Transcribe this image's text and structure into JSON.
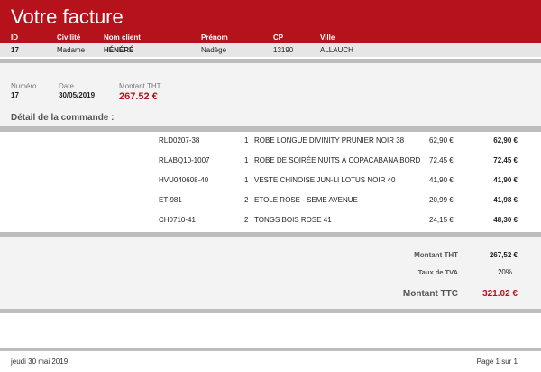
{
  "invoice": {
    "title": "Votre facture",
    "client_headers": {
      "id": "ID",
      "civilite": "Civilité",
      "nom": "Nom client",
      "prenom": "Prénom",
      "cp": "CP",
      "ville": "Ville"
    },
    "client": {
      "id": "17",
      "civilite": "Madame",
      "nom": "HÉNÉRÉ",
      "prenom": "Nadège",
      "cp": "13190",
      "ville": "ALLAUCH"
    },
    "info_labels": {
      "numero": "Numéro",
      "date": "Date",
      "montant_tht": "Montant THT"
    },
    "info": {
      "numero": "17",
      "date": "30/05/2019",
      "montant_tht": "267.52 €"
    },
    "detail_title": "Détail de la commande :",
    "lines": [
      {
        "ref": "RLD0207-38",
        "qty": "1",
        "designation": "ROBE LONGUE DIVINITY PRUNIER NOIR 38",
        "unit": "62,90 €",
        "total": "62,90 €"
      },
      {
        "ref": "RLABQ10-1007",
        "qty": "1",
        "designation": "ROBE DE SOIRÉE NUITS À COPACABANA BORD",
        "unit": "72,45 €",
        "total": "72,45 €"
      },
      {
        "ref": "HVU040608-40",
        "qty": "1",
        "designation": "VESTE CHINOISE JUN-LI LOTUS NOIR 40",
        "unit": "41,90 €",
        "total": "41,90 €"
      },
      {
        "ref": "ET-981",
        "qty": "2",
        "designation": "ETOLE ROSE - SEME AVENUE",
        "unit": "20,99 €",
        "total": "41,98 €"
      },
      {
        "ref": "CH0710-41",
        "qty": "2",
        "designation": "TONGS BOIS ROSE 41",
        "unit": "24,15 €",
        "total": "48,30 €"
      }
    ],
    "totals": {
      "tht_label": "Montant THT",
      "tht_value": "267,52 €",
      "tva_label": "Taux de TVA",
      "tva_value": "20%",
      "ttc_label": "Montant TTC",
      "ttc_value": "321.02 €"
    },
    "footer": {
      "date": "jeudi 30 mai 2019",
      "page": "Page 1 sur 1"
    },
    "colors": {
      "accent": "#b5121b",
      "band": "#e6e6e6",
      "separator": "#bdbdbd"
    }
  }
}
